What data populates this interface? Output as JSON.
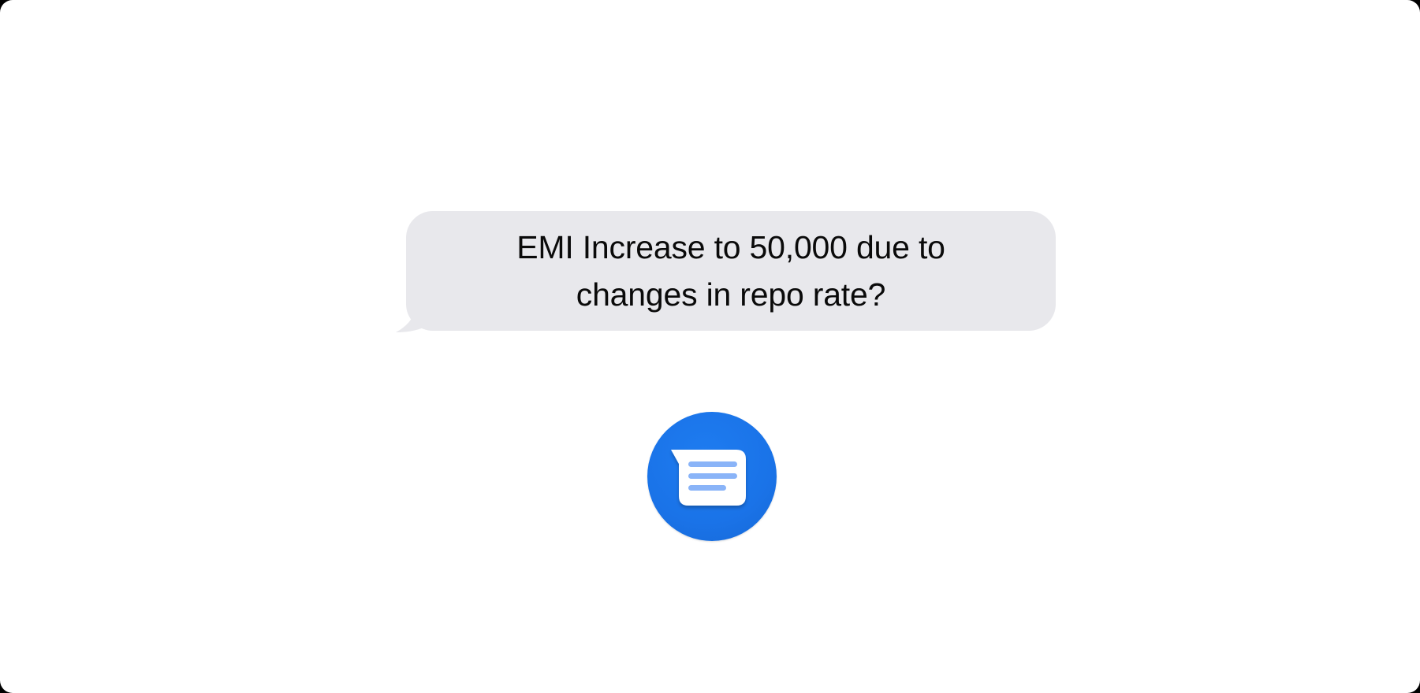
{
  "message": {
    "text": "EMI Increase to 50,000 due to changes in repo rate?",
    "bubble_color": "#e8e8ec",
    "text_color": "#0a0a0a"
  },
  "app_icon": {
    "icon": "messages-app-icon",
    "color": "#1a73e8",
    "glyph_color": "#ffffff",
    "line_color": "#8ab4f8"
  }
}
